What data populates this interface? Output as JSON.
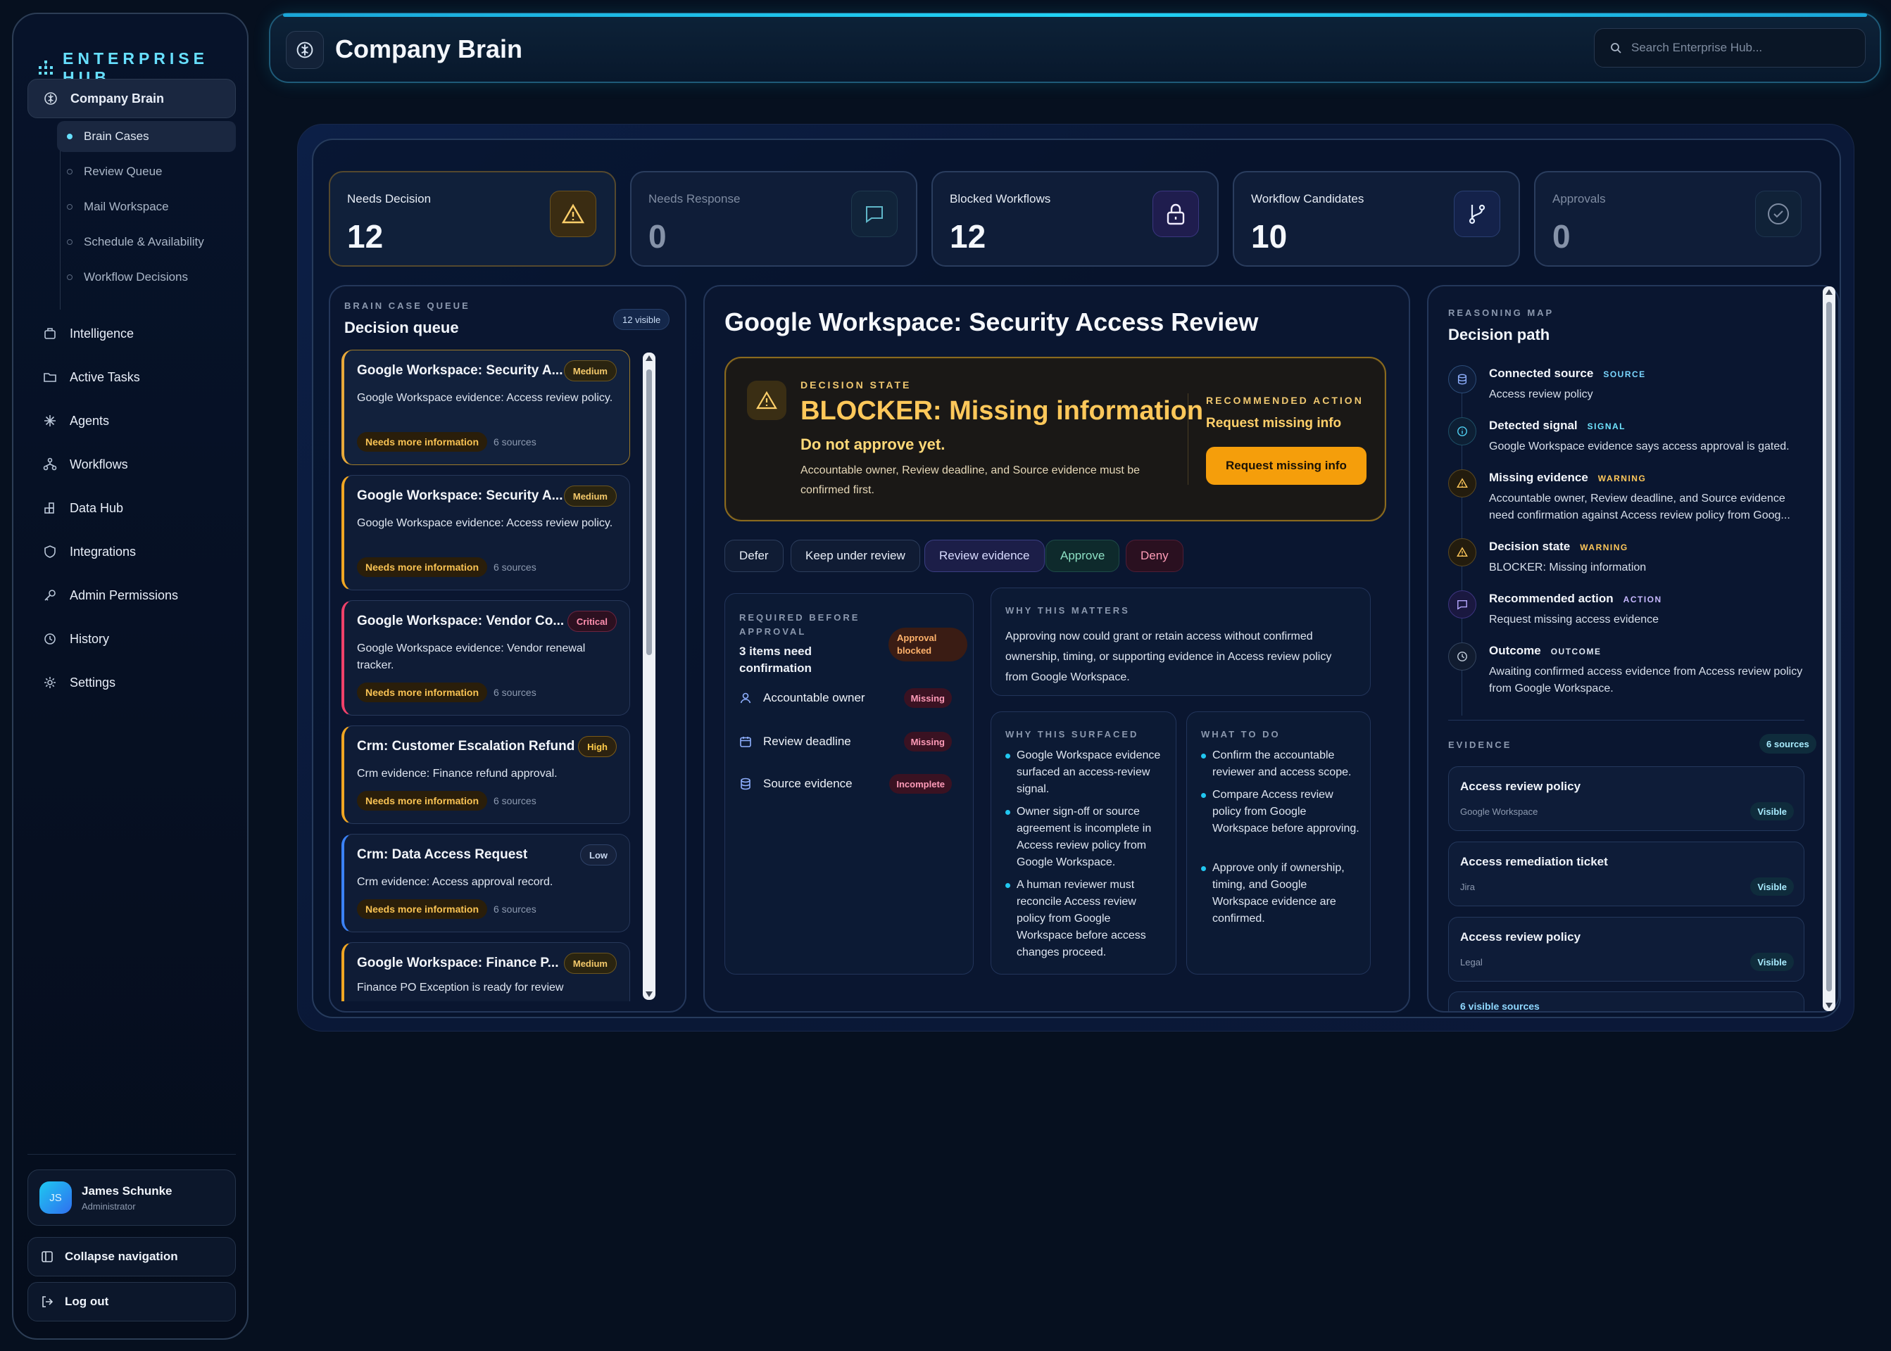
{
  "brand": "ENTERPRISE HUB",
  "sidebar": {
    "primary": {
      "label": "Company Brain",
      "icon": "brain-icon"
    },
    "sub_items": [
      {
        "label": "Brain Cases",
        "active": true
      },
      {
        "label": "Review Queue"
      },
      {
        "label": "Mail Workspace"
      },
      {
        "label": "Schedule & Availability"
      },
      {
        "label": "Workflow Decisions"
      }
    ],
    "items": [
      {
        "label": "Intelligence",
        "icon": "chart-icon"
      },
      {
        "label": "Active Tasks",
        "icon": "folder-icon"
      },
      {
        "label": "Agents",
        "icon": "sparkle-icon"
      },
      {
        "label": "Workflows",
        "icon": "workflow-icon"
      },
      {
        "label": "Data Hub",
        "icon": "grid-icon"
      },
      {
        "label": "Integrations",
        "icon": "shield-icon"
      },
      {
        "label": "Admin Permissions",
        "icon": "key-icon"
      },
      {
        "label": "History",
        "icon": "history-icon"
      },
      {
        "label": "Settings",
        "icon": "gear-icon"
      }
    ],
    "user": {
      "initials": "JS",
      "name": "James Schunke",
      "role": "Administrator"
    },
    "collapse_label": "Collapse navigation",
    "logout_label": "Log out"
  },
  "header": {
    "title": "Company Brain",
    "search_placeholder": "Search Enterprise Hub..."
  },
  "kpis": [
    {
      "label": "Needs Decision",
      "value": "12",
      "icon": "warning-icon"
    },
    {
      "label": "Needs Response",
      "value": "0",
      "icon": "message-icon"
    },
    {
      "label": "Blocked Workflows",
      "value": "12",
      "icon": "lock-icon"
    },
    {
      "label": "Workflow Candidates",
      "value": "10",
      "icon": "branch-icon"
    },
    {
      "label": "Approvals",
      "value": "0",
      "icon": "check-circle-icon"
    }
  ],
  "queue": {
    "eyebrow": "BRAIN CASE QUEUE",
    "title": "Decision queue",
    "visible_badge": "12 visible",
    "cases": [
      {
        "title": "Google Workspace: Security A...",
        "severity": "Medium",
        "desc": "Google Workspace evidence: Access review policy.",
        "status": "Needs more information",
        "sources": "6 sources"
      },
      {
        "title": "Google Workspace: Security A...",
        "severity": "Medium",
        "desc": "Google Workspace evidence: Access review policy.",
        "status": "Needs more information",
        "sources": "6 sources"
      },
      {
        "title": "Google Workspace: Vendor Co...",
        "severity": "Critical",
        "desc": "Google Workspace evidence: Vendor renewal tracker.",
        "status": "Needs more information",
        "sources": "6 sources"
      },
      {
        "title": "Crm: Customer Escalation Refund",
        "severity": "High",
        "desc": "Crm evidence: Finance refund approval.",
        "status": "Needs more information",
        "sources": "6 sources"
      },
      {
        "title": "Crm: Data Access Request",
        "severity": "Low",
        "desc": "Crm evidence: Access approval record.",
        "status": "Needs more information",
        "sources": "6 sources"
      },
      {
        "title": "Google Workspace: Finance P...",
        "severity": "Medium",
        "desc": "Finance PO Exception is ready for review"
      }
    ]
  },
  "detail": {
    "title": "Google Workspace: Security Access Review",
    "decision_state_eyebrow": "DECISION STATE",
    "decision_state": "BLOCKER: Missing information",
    "decision_sub": "Do not approve yet.",
    "decision_body": "Accountable owner, Review deadline, and Source evidence must be confirmed first.",
    "recommended_eyebrow": "RECOMMENDED ACTION",
    "recommended_label": "Request missing info",
    "recommended_button": "Request missing info",
    "actions": [
      "Defer",
      "Keep under review",
      "Review evidence",
      "Approve",
      "Deny"
    ],
    "required": {
      "eyebrow_1": "REQUIRED BEFORE",
      "eyebrow_2": "APPROVAL",
      "summary_1": "3 items need",
      "summary_2": "confirmation",
      "badge_1": "Approval",
      "badge_2": "blocked",
      "items": [
        {
          "label": "Accountable owner",
          "status": "Missing",
          "icon": "user-icon"
        },
        {
          "label": "Review deadline",
          "status": "Missing",
          "icon": "calendar-icon"
        },
        {
          "label": "Source evidence",
          "status": "Incomplete",
          "icon": "database-icon"
        }
      ]
    },
    "why_matters": {
      "eyebrow": "WHY THIS MATTERS",
      "body": "Approving now could grant or retain access without confirmed ownership, timing, or supporting evidence in Access review policy from Google Workspace."
    },
    "why_surfaced": {
      "eyebrow": "WHY THIS SURFACED",
      "bullets": [
        "Google Workspace evidence surfaced an access-review signal.",
        "Owner sign-off or source agreement is incomplete in Access review policy from Google Workspace.",
        "A human reviewer must reconcile Access review policy from Google Workspace before access changes proceed."
      ]
    },
    "what_to_do": {
      "eyebrow": "WHAT TO DO",
      "bullets": [
        "Confirm the accountable reviewer and access scope.",
        "Compare Access review policy from Google Workspace before approving.",
        "Approve only if ownership, timing, and Google Workspace evidence are confirmed."
      ]
    }
  },
  "reasoning": {
    "eyebrow": "REASONING MAP",
    "title": "Decision path",
    "steps": [
      {
        "title": "Connected source",
        "tag": "SOURCE",
        "desc": "Access review policy",
        "icon": "database-icon"
      },
      {
        "title": "Detected signal",
        "tag": "SIGNAL",
        "desc": "Google Workspace evidence says access approval is gated.",
        "icon": "info-icon"
      },
      {
        "title": "Missing evidence",
        "tag": "WARNING",
        "desc": "Accountable owner, Review deadline, and Source evidence need confirmation against Access review policy from Goog...",
        "icon": "warning-icon"
      },
      {
        "title": "Decision state",
        "tag": "WARNING",
        "desc": "BLOCKER: Missing information",
        "icon": "warning-icon"
      },
      {
        "title": "Recommended action",
        "tag": "ACTION",
        "desc": "Request missing access evidence",
        "icon": "message-icon"
      },
      {
        "title": "Outcome",
        "tag": "OUTCOME",
        "desc": "Awaiting confirmed access evidence from Access review policy from Google Workspace.",
        "icon": "clock-icon"
      }
    ],
    "evidence_eyebrow": "EVIDENCE",
    "evidence_badge": "6 sources",
    "evidence": [
      {
        "name": "Access review policy",
        "source": "Google Workspace",
        "status": "Visible"
      },
      {
        "name": "Access remediation ticket",
        "source": "Jira",
        "status": "Visible"
      },
      {
        "name": "Access review policy",
        "source": "Legal",
        "status": "Visible"
      }
    ],
    "more_sources": "6 visible sources"
  },
  "colors": {
    "accent": "#21d3f5",
    "warning": "#f59e0b",
    "critical": "#ff6b8f",
    "background": "#06101f"
  }
}
